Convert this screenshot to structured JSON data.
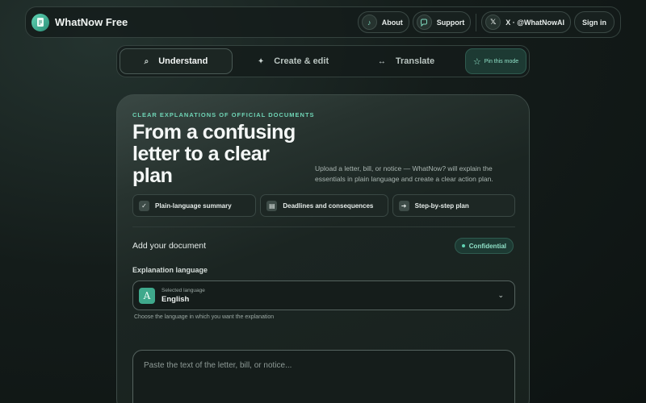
{
  "header": {
    "app_name": "WhatNow Free",
    "about_label": "About",
    "support_label": "Support",
    "x_label": "X · @WhatNowAI",
    "signin_label": "Sign in"
  },
  "modes": [
    {
      "label": "Understand",
      "icon": "search-icon",
      "glyph": "⌕",
      "active": true
    },
    {
      "label": "Create & edit",
      "icon": "sparkle-icon",
      "glyph": "✦",
      "active": false
    },
    {
      "label": "Translate",
      "icon": "arrows-icon",
      "glyph": "↔",
      "active": false
    }
  ],
  "pin_label": "Pin this mode",
  "hero": {
    "eyebrow": "CLEAR EXPLANATIONS OF OFFICIAL DOCUMENTS",
    "headline": "From a confusing letter to a clear plan",
    "lead": "Upload a letter, bill, or notice — WhatNow? will explain the essentials in plain language and create a clear action plan."
  },
  "features": [
    {
      "label": "Plain-language summary",
      "icon": "check-icon",
      "glyph": "✓"
    },
    {
      "label": "Deadlines and consequences",
      "icon": "calendar-icon",
      "glyph": "▤"
    },
    {
      "label": "Step-by-step plan",
      "icon": "arrow-right-icon",
      "glyph": "➜"
    }
  ],
  "document": {
    "title": "Add your document",
    "confidential_label": "Confidential",
    "language_label": "Explanation language",
    "selected_caption": "Selected language",
    "selected_value": "English",
    "language_badge": "A",
    "language_hint": "Choose the language in which you want the explanation",
    "textarea_placeholder": "Paste the text of the letter, bill, or notice..."
  },
  "colors": {
    "accent": "#5fd3b3",
    "background": "#141c1a",
    "card": "#1b2522"
  }
}
